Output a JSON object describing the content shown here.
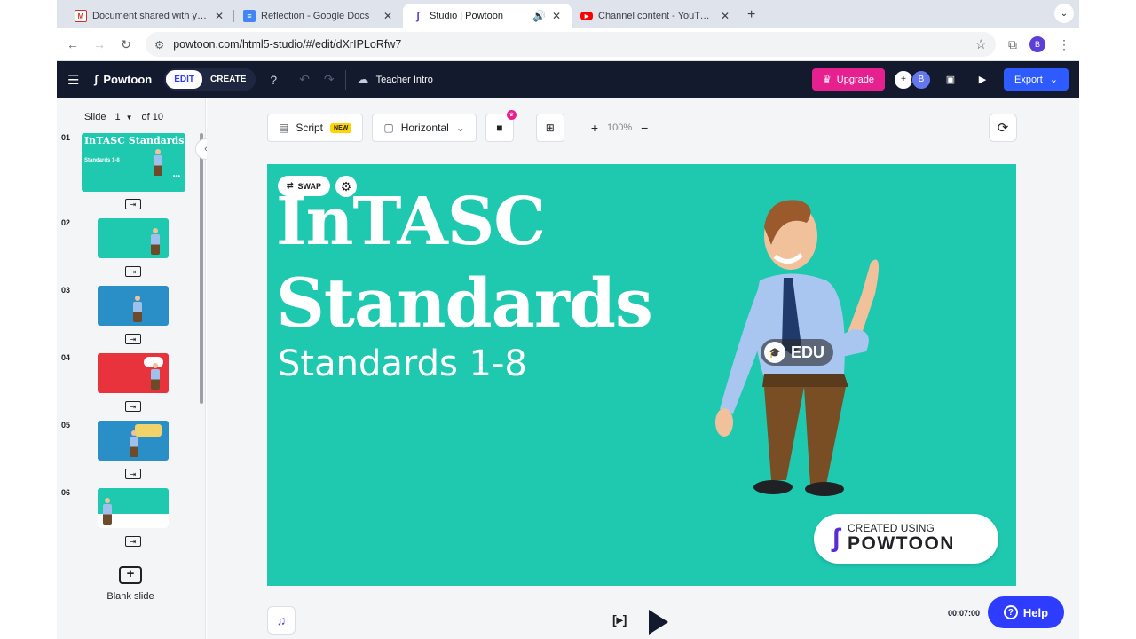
{
  "browser": {
    "tabs": [
      {
        "title": "Document shared with you: \"",
        "favicon": "gmail-icon"
      },
      {
        "title": "Reflection - Google Docs",
        "favicon": "docs-icon"
      },
      {
        "title": "Studio | Powtoon",
        "favicon": "powtoon-icon",
        "active": true
      },
      {
        "title": "Channel content - YouTube S",
        "favicon": "youtube-icon"
      }
    ],
    "url": "powtoon.com/html5-studio/#/edit/dXrIPLoRfw7",
    "profile_initial": "B"
  },
  "header": {
    "brand": "Powtoon",
    "mode_edit": "EDIT",
    "mode_create": "CREATE",
    "project_title": "Teacher Intro",
    "upgrade_label": "Upgrade",
    "avatar_initial": "B",
    "export_label": "Export"
  },
  "sidebar": {
    "slide_label": "Slide",
    "current_slide": "1",
    "of_label": "of 10",
    "slides": [
      {
        "number": "01",
        "title": "InTASC Standards",
        "subtitle": "Standards 1-8",
        "color": "#1ec9b0"
      },
      {
        "number": "02",
        "title": "",
        "subtitle": "",
        "color": "#1ec9b0"
      },
      {
        "number": "03",
        "title": "",
        "subtitle": "",
        "color": "#2a8fc7"
      },
      {
        "number": "04",
        "title": "",
        "subtitle": "",
        "color": "#e8333d"
      },
      {
        "number": "05",
        "title": "",
        "subtitle": "",
        "color": "#2a8fc7"
      },
      {
        "number": "06",
        "title": "",
        "subtitle": "",
        "color": "#1ec9b0"
      }
    ],
    "blank_slide_label": "Blank slide"
  },
  "toolbar": {
    "script_label": "Script",
    "new_badge": "NEW",
    "orientation_label": "Horizontal",
    "zoom_label": "100%"
  },
  "stage": {
    "swap_label": "SWAP",
    "title_line1": "InTASC",
    "title_line2": "Standards",
    "subtitle": "Standards 1-8",
    "edu_badge": "EDU",
    "created_using": "CREATED USING",
    "powtoon_wordmark": "POWTOON",
    "background_color": "#1ec9b0"
  },
  "bottom": {
    "time": "00:07:00",
    "help_label": "Help"
  }
}
